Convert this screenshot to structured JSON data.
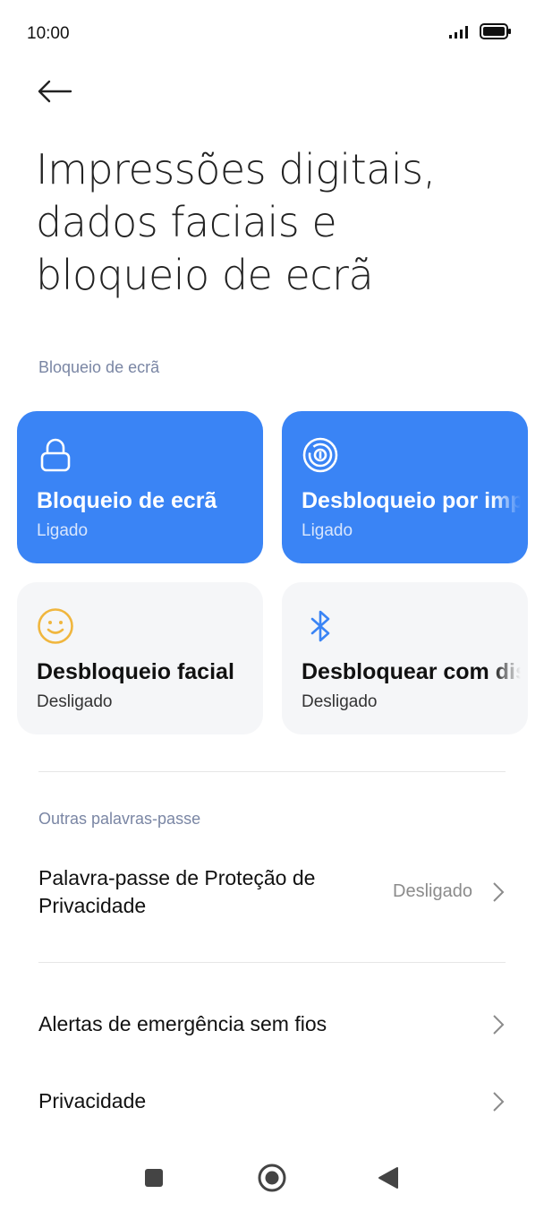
{
  "status_bar": {
    "time": "10:00"
  },
  "header": {
    "title": "Impressões digitais, dados faciais e bloqueio de ecrã"
  },
  "lock_section": {
    "label": "Bloqueio de ecrã",
    "tiles": [
      {
        "title": "Bloqueio de ecrã",
        "status": "Ligado",
        "icon": "lock-icon",
        "enabled": true
      },
      {
        "title": "Desbloqueio por impressão digital",
        "status": "Ligado",
        "icon": "fingerprint-icon",
        "enabled": true
      },
      {
        "title": "Desbloqueio facial",
        "status": "Desligado",
        "icon": "face-icon",
        "enabled": false
      },
      {
        "title": "Desbloquear com dispositivo Bluetooth",
        "status": "Desligado",
        "icon": "bluetooth-icon",
        "enabled": false
      }
    ]
  },
  "other_passwords": {
    "label": "Outras palavras-passe",
    "privacy_password": {
      "title_line1": "Palavra-passe de Proteção de",
      "title_line2": "Privacidade",
      "value": "Desligado"
    }
  },
  "more": {
    "items": [
      {
        "title": "Alertas de emergência sem fios"
      },
      {
        "title": "Privacidade"
      }
    ]
  },
  "colors": {
    "accent": "#3a84f5",
    "tile_off": "#f5f6f8",
    "face_icon": "#f0b63e"
  }
}
